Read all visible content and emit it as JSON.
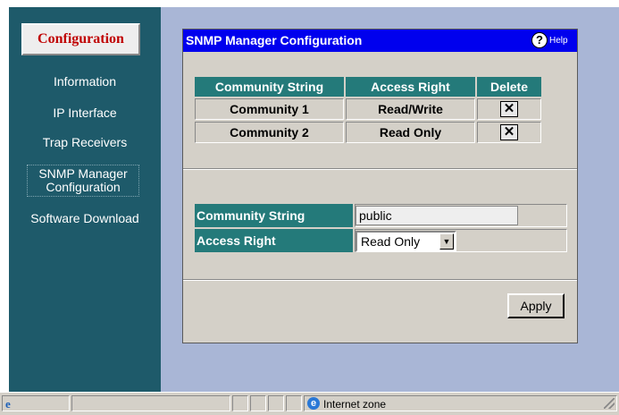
{
  "sidebar": {
    "header_button": "Configuration",
    "items": [
      {
        "label": "Information"
      },
      {
        "label": "IP Interface"
      },
      {
        "label": "Trap Receivers"
      },
      {
        "label_line1": "SNMP Manager",
        "label_line2": "Configuration"
      },
      {
        "label": "Software Download"
      }
    ]
  },
  "panel": {
    "title": "SNMP Manager Configuration",
    "help_label": "Help",
    "help_icon": "question-mark-icon"
  },
  "community_table": {
    "headers": [
      "Community String",
      "Access Right",
      "Delete"
    ],
    "rows": [
      {
        "community": "Community 1",
        "access": "Read/Write",
        "delete": "✕"
      },
      {
        "community": "Community 2",
        "access": "Read Only",
        "delete": "✕"
      }
    ]
  },
  "form": {
    "community_label": "Community String",
    "community_value": "public",
    "access_label": "Access Right",
    "access_selected": "Read Only",
    "apply_label": "Apply"
  },
  "statusbar": {
    "zone_text": "Internet zone"
  },
  "colors": {
    "sidebar_bg": "#1e5a6a",
    "title_bar": "#0000ee",
    "table_header": "#247a7a",
    "config_text": "#c00000"
  }
}
